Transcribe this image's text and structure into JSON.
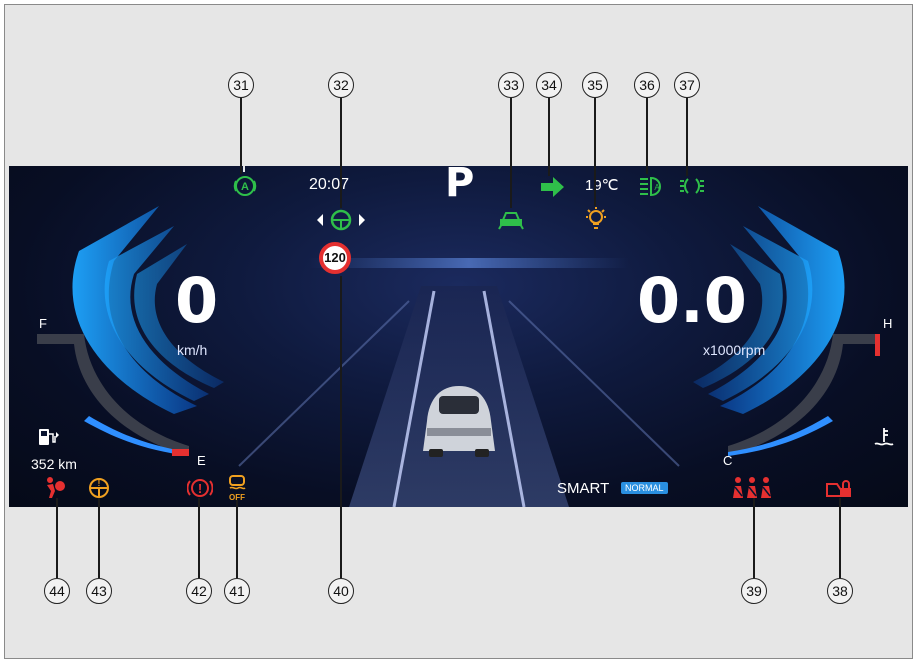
{
  "status": {
    "time": "20:07",
    "gear": "P",
    "outside_temp": "19℃"
  },
  "speed": {
    "value": "0",
    "unit": "km/h"
  },
  "tach": {
    "value": "0.0",
    "unit": "x1000rpm"
  },
  "speed_limit": "120",
  "fuel": {
    "range": "352 km",
    "full_label": "F",
    "empty_label": "E"
  },
  "temp_gauge": {
    "hot_label": "H",
    "cold_label": "C"
  },
  "drive_mode": {
    "mode": "SMART",
    "badge": "NORMAL"
  },
  "callouts": [
    "31",
    "32",
    "33",
    "34",
    "35",
    "36",
    "37",
    "38",
    "39",
    "40",
    "41",
    "42",
    "43",
    "44"
  ],
  "indicator_icons": {
    "31": "auto-hold-icon",
    "32": "steering-assist-icon",
    "33": "front-vehicle-icon",
    "34": "turn-signal-icon",
    "35": "bulb-fault-icon",
    "36": "auto-headlight-icon",
    "37": "position-lamp-icon",
    "38": "door-lock-icon",
    "39": "seatbelt-reminder-icon",
    "40": "speed-limit-sign-icon",
    "41": "esp-off-icon",
    "42": "brake-warning-icon",
    "43": "steering-fault-icon",
    "44": "airbag-warning-icon"
  },
  "colors": {
    "green": "#2fbf4a",
    "amber": "#f0a020",
    "red": "#e53030",
    "blue": "#3aa8ff"
  }
}
